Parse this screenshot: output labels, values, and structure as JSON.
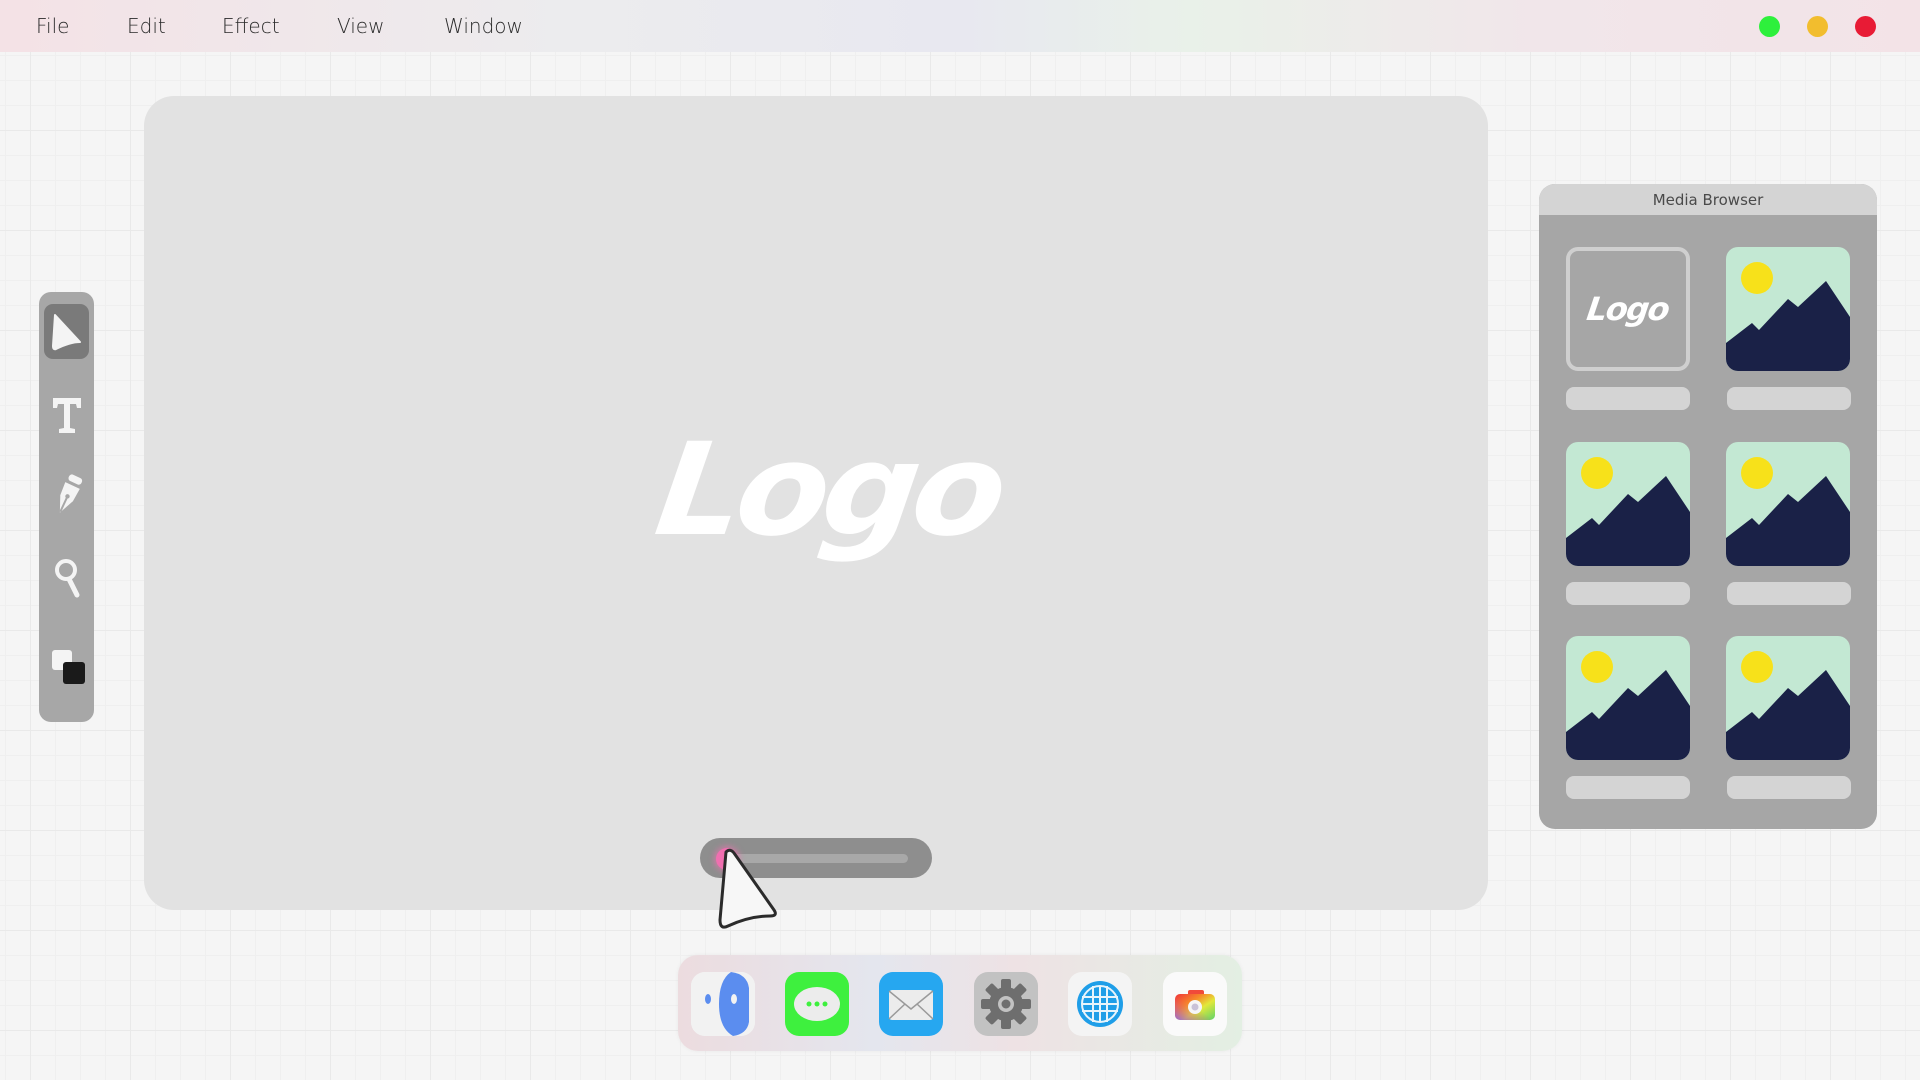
{
  "menubar": {
    "items": [
      {
        "label": "File"
      },
      {
        "label": "Edit"
      },
      {
        "label": "Effect"
      },
      {
        "label": "View"
      },
      {
        "label": "Window"
      }
    ],
    "window_controls": [
      {
        "name": "maximize",
        "color": "#2ef03c"
      },
      {
        "name": "minimize",
        "color": "#f2bd2e"
      },
      {
        "name": "close",
        "color": "#e81b35"
      }
    ]
  },
  "canvas": {
    "logo_text": "Logo",
    "background": "#e2e2e2"
  },
  "timeline": {
    "progress": 0.0
  },
  "tools": [
    {
      "name": "select-tool",
      "icon": "pointer-icon",
      "active": true
    },
    {
      "name": "text-tool",
      "icon": "text-icon",
      "label": "T",
      "active": false
    },
    {
      "name": "pen-tool",
      "icon": "pen-nib-icon",
      "active": false
    },
    {
      "name": "zoom-tool",
      "icon": "magnifier-icon",
      "active": false
    },
    {
      "name": "color-swatch-tool",
      "icon": "fill-stroke-icon",
      "active": false,
      "fill": "#f4f4f4",
      "stroke": "#1a1a1a"
    }
  ],
  "media_browser": {
    "title": "Media Browser",
    "items": [
      {
        "type": "logo",
        "text": "Logo",
        "selected": true
      },
      {
        "type": "image",
        "icon": "landscape-image-icon"
      },
      {
        "type": "image",
        "icon": "landscape-image-icon"
      },
      {
        "type": "image",
        "icon": "landscape-image-icon"
      },
      {
        "type": "image",
        "icon": "landscape-image-icon"
      },
      {
        "type": "image",
        "icon": "landscape-image-icon"
      }
    ],
    "colors": {
      "sky": "#c3e8d3",
      "sun": "#f7e11a",
      "mountain": "#1a2147"
    }
  },
  "dock": {
    "apps": [
      {
        "name": "finder",
        "icon": "finder-icon"
      },
      {
        "name": "messages",
        "icon": "message-bubble-icon",
        "color": "#3ef03e"
      },
      {
        "name": "mail",
        "icon": "envelope-icon",
        "color": "#26a7f0"
      },
      {
        "name": "settings",
        "icon": "gear-icon",
        "color": "#c2c2c2"
      },
      {
        "name": "browser",
        "icon": "globe-icon",
        "color": "#1f9ee8"
      },
      {
        "name": "camera",
        "icon": "camera-icon"
      }
    ]
  }
}
